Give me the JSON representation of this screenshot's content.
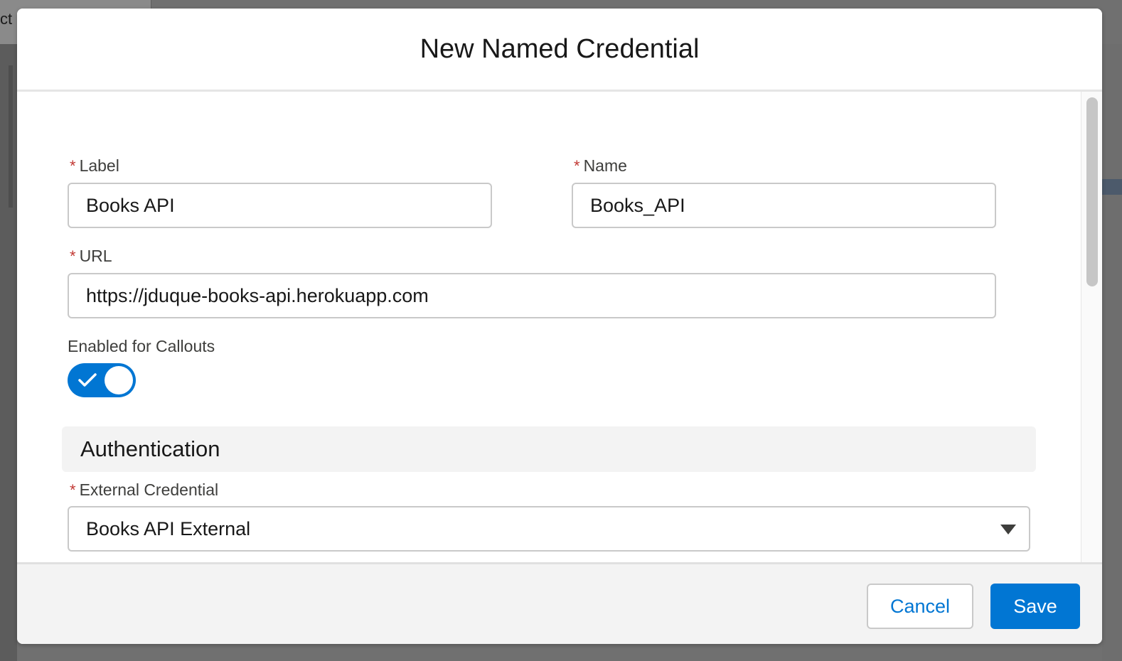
{
  "background": {
    "tab_text": "ct"
  },
  "modal": {
    "title": "New Named Credential",
    "fields": {
      "label": {
        "label": "Label",
        "required_mark": "*",
        "value": "Books API"
      },
      "name": {
        "label": "Name",
        "required_mark": "*",
        "value": "Books_API"
      },
      "url": {
        "label": "URL",
        "required_mark": "*",
        "value": "https://jduque-books-api.herokuapp.com"
      },
      "callouts": {
        "label": "Enabled for Callouts",
        "enabled": true
      },
      "external_credential": {
        "label": "External Credential",
        "required_mark": "*",
        "value": "Books API External"
      }
    },
    "sections": {
      "authentication": {
        "title": "Authentication"
      }
    },
    "footer": {
      "cancel_label": "Cancel",
      "save_label": "Save"
    }
  },
  "colors": {
    "brand": "#0176d3",
    "required": "#c23934",
    "section_bg": "#f3f3f3"
  },
  "icons": {
    "toggle_check": "check-icon",
    "select_arrow": "triangle-down-icon"
  }
}
